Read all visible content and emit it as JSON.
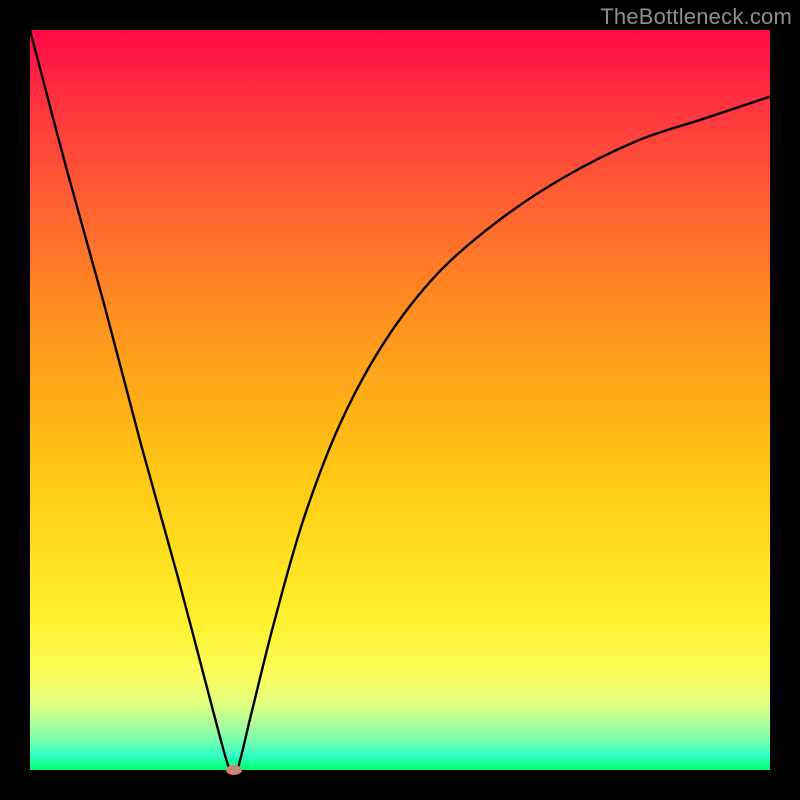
{
  "watermark": "TheBottleneck.com",
  "chart_data": {
    "type": "line",
    "title": "",
    "xlabel": "",
    "ylabel": "",
    "xlim": [
      0,
      100
    ],
    "ylim": [
      0,
      100
    ],
    "grid": false,
    "series": [
      {
        "name": "curve",
        "x": [
          0,
          5,
          10,
          15,
          20,
          25,
          27,
          28,
          30,
          33,
          37,
          42,
          48,
          55,
          63,
          72,
          82,
          91,
          100
        ],
        "y": [
          100,
          81,
          63,
          44,
          26,
          7,
          0,
          0,
          8,
          20,
          34,
          47,
          58,
          67,
          74,
          80,
          85,
          88,
          91
        ]
      }
    ],
    "marker": {
      "x": 27.5,
      "y": 0
    },
    "background_gradient_stops": [
      {
        "pos": 0,
        "color": "#ff0a46"
      },
      {
        "pos": 9,
        "color": "#ff2f3f"
      },
      {
        "pos": 22,
        "color": "#ff5c35"
      },
      {
        "pos": 34,
        "color": "#ff8224"
      },
      {
        "pos": 46,
        "color": "#ffa31a"
      },
      {
        "pos": 58,
        "color": "#ffc213"
      },
      {
        "pos": 70,
        "color": "#ffdd20"
      },
      {
        "pos": 80,
        "color": "#fff12f"
      },
      {
        "pos": 87,
        "color": "#fcfc5a"
      },
      {
        "pos": 91,
        "color": "#e0ff7e"
      },
      {
        "pos": 94,
        "color": "#a8ff9c"
      },
      {
        "pos": 96.5,
        "color": "#66ffb3"
      },
      {
        "pos": 98,
        "color": "#33ffc6"
      },
      {
        "pos": 100,
        "color": "#00ff66"
      }
    ]
  }
}
